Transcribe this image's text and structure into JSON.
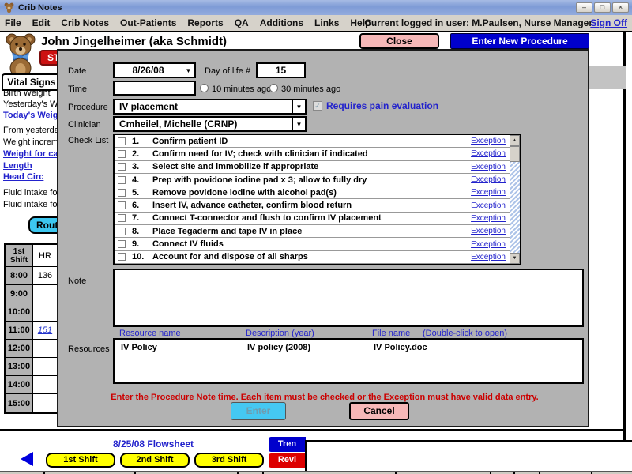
{
  "colors": {
    "accent_blue": "#0000cc",
    "alert_red": "#cc0000",
    "button_pink": "#f6b8b8",
    "button_cyan": "#45c8f2",
    "button_yellow": "#ffff00",
    "link_blue": "#2222cc",
    "dialog_gray": "#b2b2b2"
  },
  "window": {
    "title": "Crib Notes",
    "minimize_glyph": "–",
    "maximize_glyph": "□",
    "close_glyph": "×"
  },
  "menubar": {
    "items": [
      "File",
      "Edit",
      "Crib Notes",
      "Out-Patients",
      "Reports",
      "QA",
      "Additions",
      "Links",
      "Help"
    ],
    "logged_in_text": "Current logged in user: M.Paulsen, Nurse Manager",
    "sign_off_label": "Sign Off"
  },
  "header": {
    "patient_name": "John Jingelheimer (aka Schmidt)",
    "stat_button_label": "ST",
    "close_button_label": "Close",
    "enter_new_procedure_label": "Enter New Procedure"
  },
  "sidebar": {
    "tab_label": "Vital Signs",
    "items": [
      {
        "label": "Birth Weight"
      },
      {
        "label": "Yesterday's We"
      },
      {
        "label": "Today's Weight"
      },
      {
        "label": "From yesterda"
      },
      {
        "label": "Weight increme"
      },
      {
        "label": "Weight for calc"
      },
      {
        "label": "Length"
      },
      {
        "label": "Head Circ"
      },
      {
        "label": "Fluid intake for"
      },
      {
        "label": "Fluid intake for"
      }
    ],
    "routine_button_label": "Routi"
  },
  "flowsheet": {
    "header_shift": "1st Shift",
    "header_hr": "HR",
    "rows": [
      {
        "time": "8:00",
        "hr": "136"
      },
      {
        "time": "9:00",
        "hr": ""
      },
      {
        "time": "10:00",
        "hr": ""
      },
      {
        "time": "11:00",
        "hr": "151"
      },
      {
        "time": "12:00",
        "hr": ""
      },
      {
        "time": "13:00",
        "hr": ""
      },
      {
        "time": "14:00",
        "hr": ""
      },
      {
        "time": "15:00",
        "hr": ""
      }
    ],
    "footer_title": "8/25/08 Flowsheet",
    "shift_buttons": [
      "1st Shift",
      "2nd Shift",
      "3rd Shift"
    ],
    "trend_button_label": "Tren",
    "review_button_label": "Revi"
  },
  "dialog": {
    "date_label": "Date",
    "date_value": "8/26/08",
    "day_of_life_label": "Day of life #",
    "day_of_life_value": "15",
    "time_label": "Time",
    "time_value": "",
    "radio_10_label": "10 minutes ago",
    "radio_30_label": "30 minutes ago",
    "procedure_label": "Procedure",
    "procedure_value": "IV placement",
    "requires_pain_label": "Requires pain evaluation",
    "clinician_label": "Clinician",
    "clinician_value": "Cmheilel, Michelle (CRNP)",
    "checklist_label": "Check List",
    "exception_label": "Exception",
    "checklist": [
      {
        "num": "1.",
        "text": "Confirm patient ID"
      },
      {
        "num": "2.",
        "text": "Confirm need for IV; check with clinician if indicated"
      },
      {
        "num": "3.",
        "text": "Select site and immobilize if appropriate"
      },
      {
        "num": "4.",
        "text": "Prep with povidone iodine pad x 3; allow to fully dry"
      },
      {
        "num": "5.",
        "text": "Remove povidone iodine with alcohol pad(s)"
      },
      {
        "num": "6.",
        "text": "Insert IV, advance catheter, confirm blood return"
      },
      {
        "num": "7.",
        "text": "Connect T-connector and flush to confirm IV placement"
      },
      {
        "num": "8.",
        "text": "Place Tegaderm and tape IV in place"
      },
      {
        "num": "9.",
        "text": "Connect IV fluids"
      },
      {
        "num": "10.",
        "text": "Account for and dispose of all sharps"
      }
    ],
    "note_label": "Note",
    "resources_label": "Resources",
    "resource_headers": {
      "name": "Resource name",
      "description": "Description (year)",
      "file": "File name",
      "hint": "(Double-click to open)"
    },
    "resources": [
      {
        "name": "IV Policy",
        "description": "IV policy (2008)",
        "file": "IV Policy.doc"
      }
    ],
    "validation_message": "Enter the Procedure Note time. Each item must be checked or the Exception must have valid data entry.",
    "enter_button_label": "Enter",
    "cancel_button_label": "Cancel"
  }
}
